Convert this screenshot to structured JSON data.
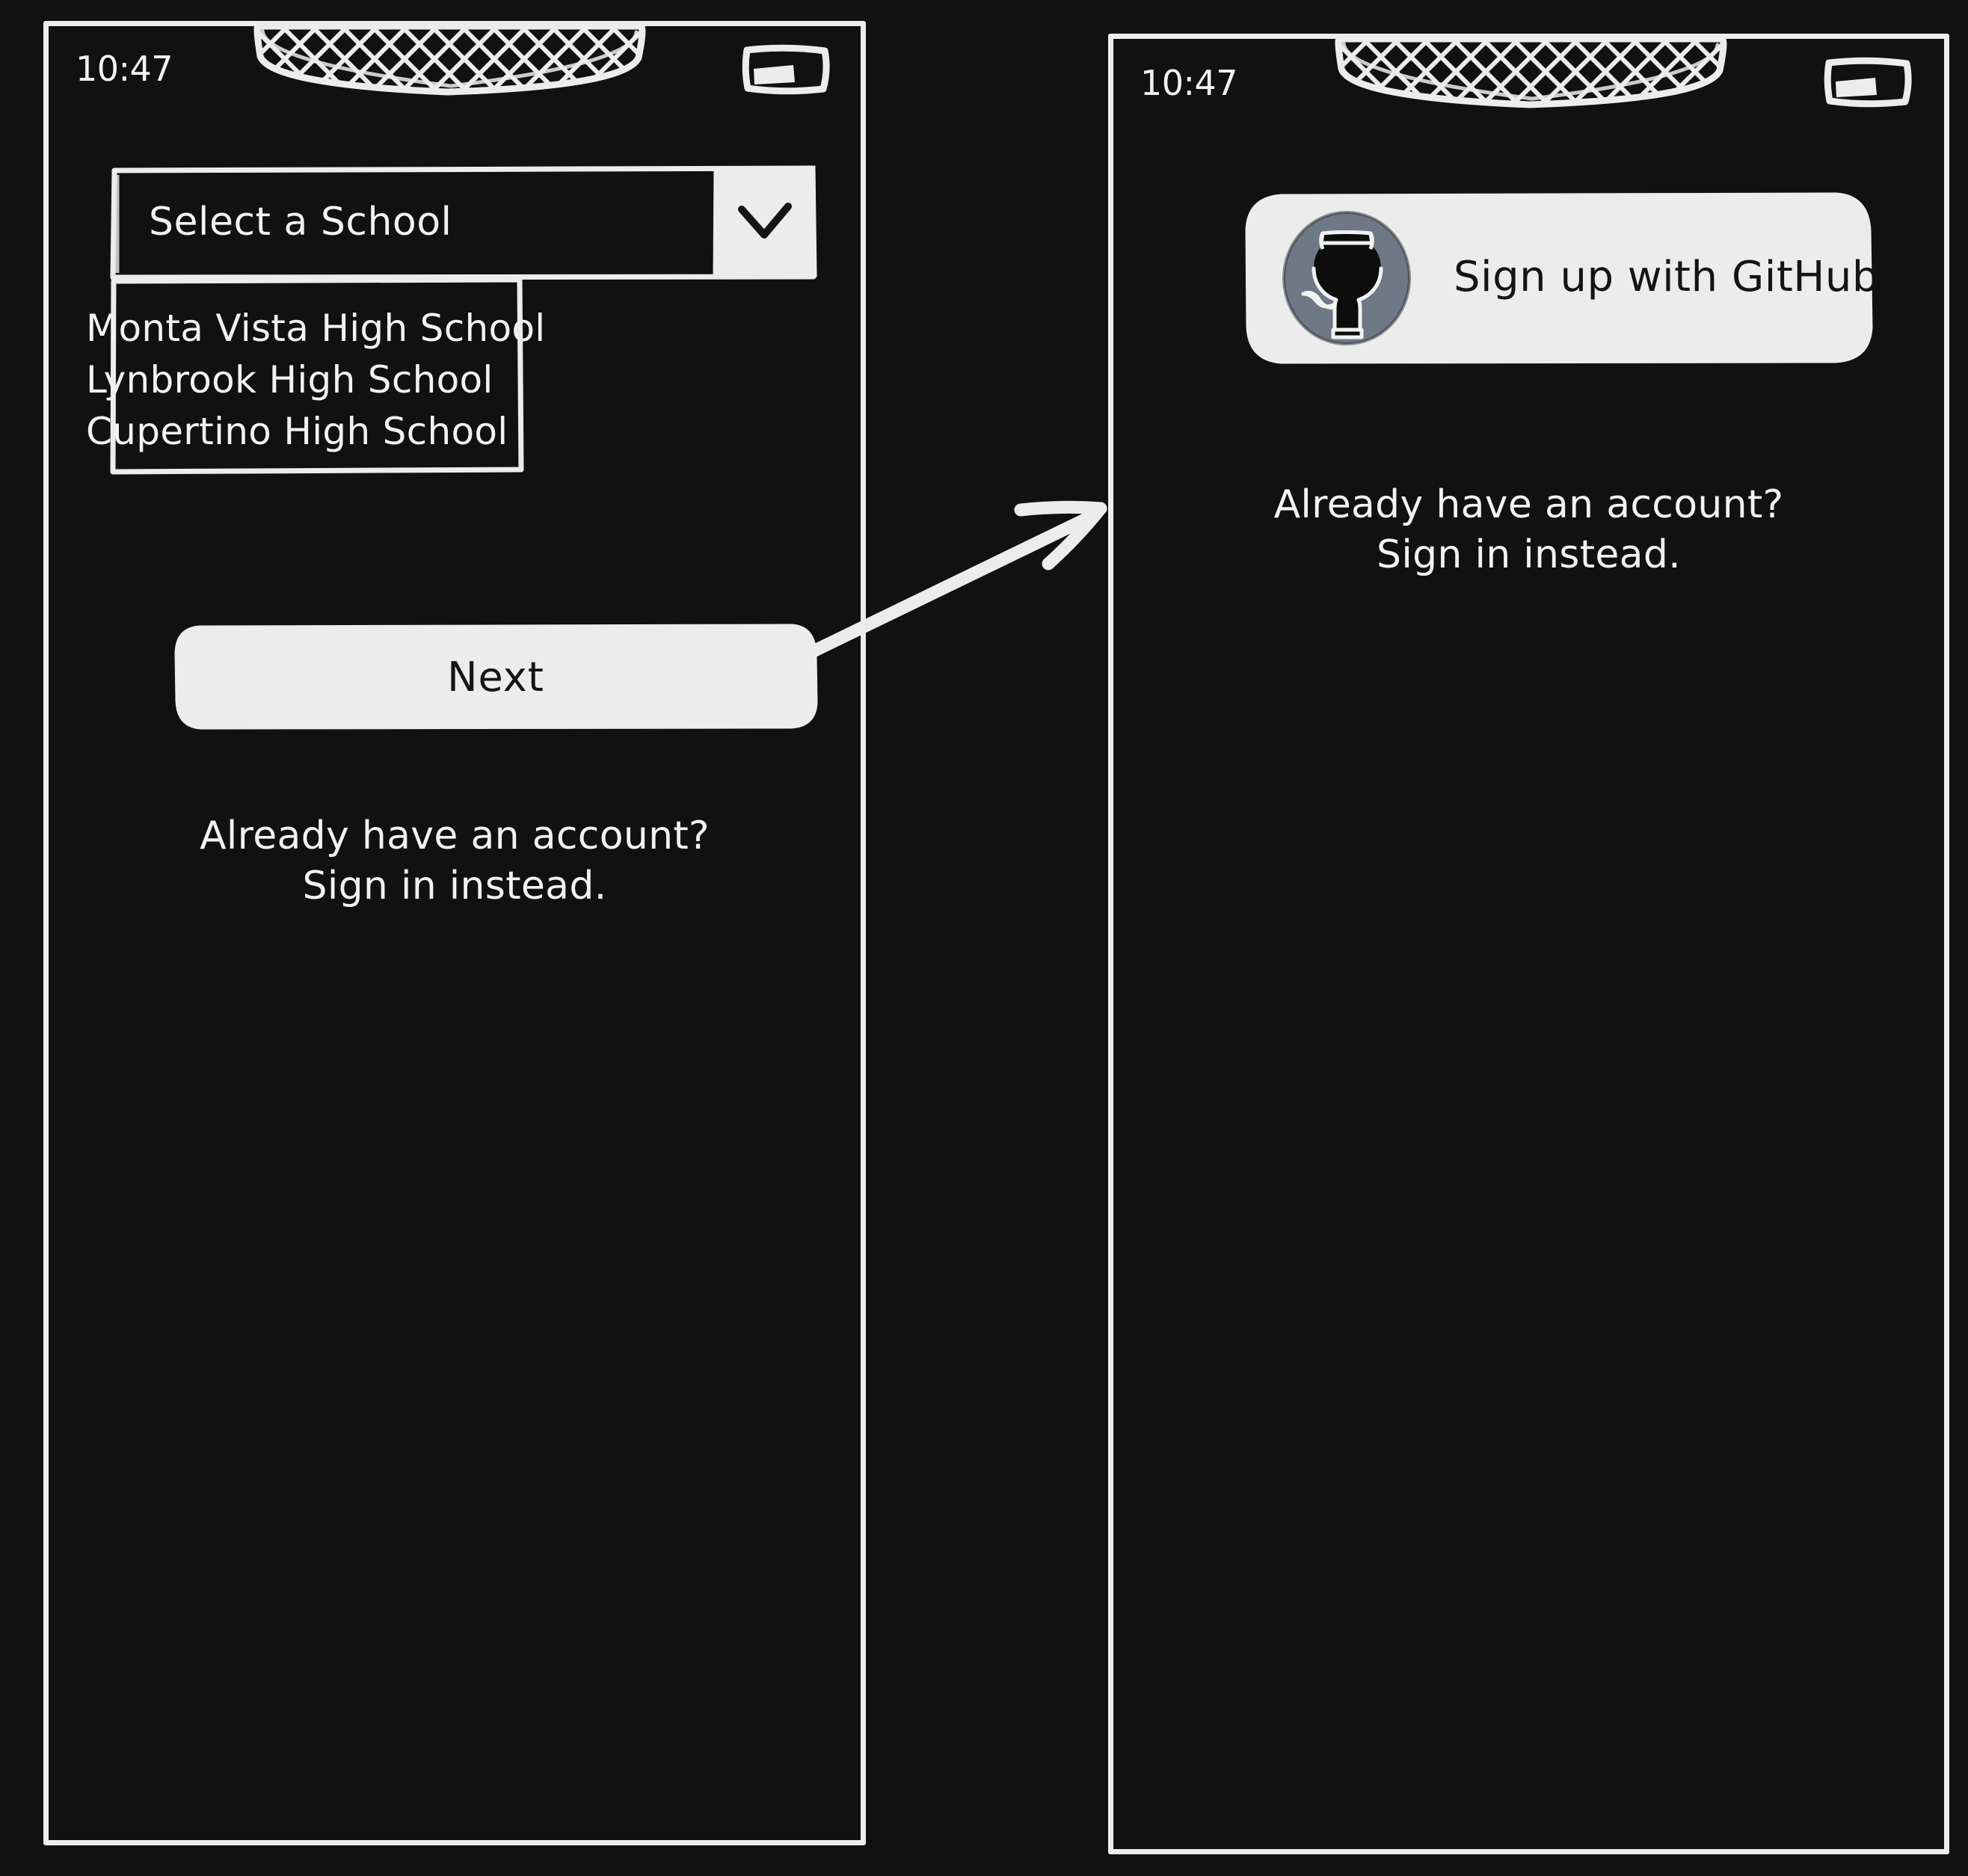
{
  "theme": {
    "background": "#111111",
    "stroke": "#ececec",
    "fill_light": "#ececec",
    "text_light": "#f2f2f2",
    "text_dark": "#141414",
    "github_avatar": "#6e7887"
  },
  "screens": [
    {
      "id": "school-select-screen",
      "status_bar": {
        "time": "10:47",
        "notch_icon": "notch-hatched",
        "battery_icon": "battery-icon"
      },
      "select": {
        "value": "Select a School",
        "placeholder": "Select a School",
        "chevron_icon": "chevron-down-icon",
        "expanded": true,
        "options": [
          "Monta Vista High School",
          "Lynbrook High School",
          "Cupertino High School"
        ]
      },
      "next_button": {
        "label": "Next"
      },
      "signin": {
        "line1": "Already have an account?",
        "line2": "Sign in instead."
      }
    },
    {
      "id": "github-signup-screen",
      "status_bar": {
        "time": "10:47",
        "notch_icon": "notch-hatched",
        "battery_icon": "battery-icon"
      },
      "github_button": {
        "label": "Sign up with GitHub",
        "icon": "github-octocat-icon"
      },
      "signin": {
        "line1": "Already have an account?",
        "line2": "Sign in instead."
      }
    }
  ],
  "flow": {
    "arrow_icon": "arrow-right-icon",
    "from": "school-select-screen",
    "to": "github-signup-screen"
  }
}
